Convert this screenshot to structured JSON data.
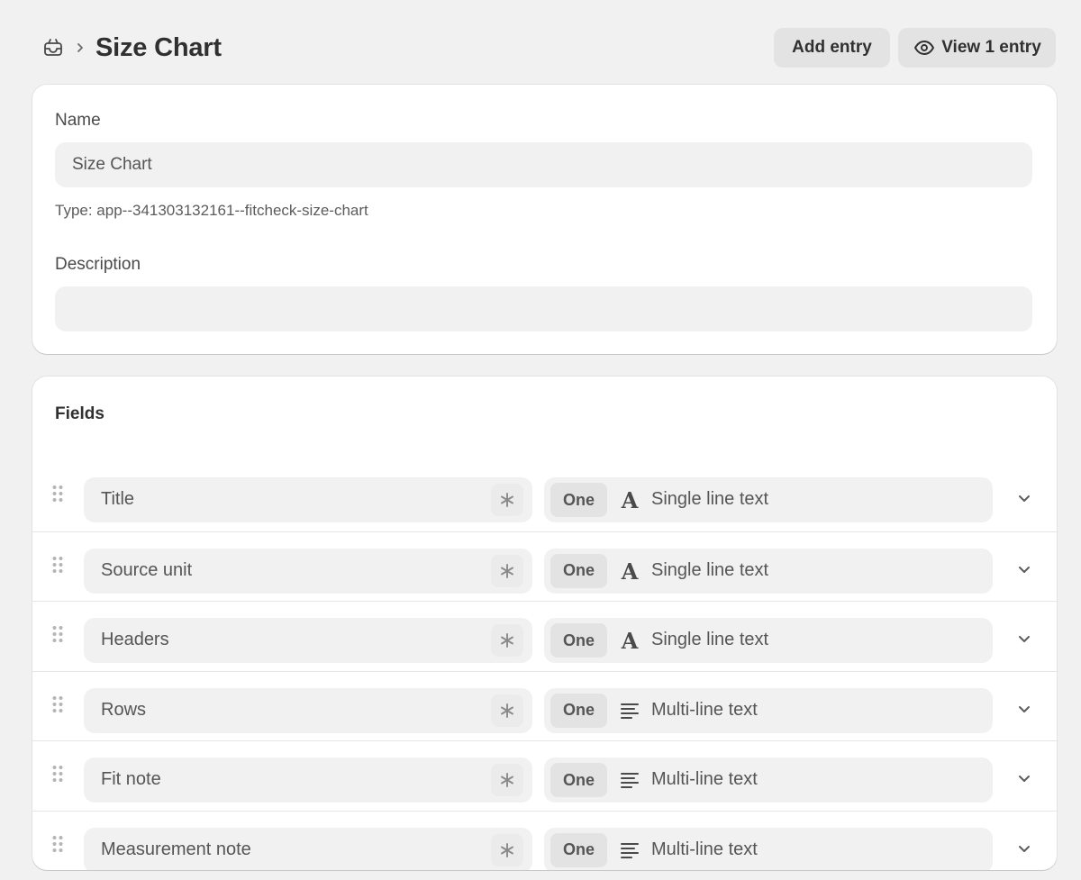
{
  "header": {
    "breadcrumb_icon": "metaobject-icon",
    "title": "Size Chart",
    "add_entry_label": "Add entry",
    "view_entry_label": "View 1 entry"
  },
  "definition": {
    "name_label": "Name",
    "name_value": "Size Chart",
    "type_line": "Type: app--341303132161--fitcheck-size-chart",
    "description_label": "Description",
    "description_value": ""
  },
  "fields": {
    "title": "Fields",
    "rows": [
      {
        "name": "Title",
        "cardinality": "One",
        "type": "Single line text",
        "type_icon": "text-A-icon"
      },
      {
        "name": "Source unit",
        "cardinality": "One",
        "type": "Single line text",
        "type_icon": "text-A-icon"
      },
      {
        "name": "Headers",
        "cardinality": "One",
        "type": "Single line text",
        "type_icon": "text-A-icon"
      },
      {
        "name": "Rows",
        "cardinality": "One",
        "type": "Multi-line text",
        "type_icon": "multiline-icon"
      },
      {
        "name": "Fit note",
        "cardinality": "One",
        "type": "Multi-line text",
        "type_icon": "multiline-icon"
      },
      {
        "name": "Measurement note",
        "cardinality": "One",
        "type": "Multi-line text",
        "type_icon": "multiline-icon"
      }
    ]
  },
  "colors": {
    "background": "#f1f1f1",
    "card": "#ffffff",
    "input": "#f1f1f1",
    "button": "#e3e3e3",
    "text": "#303030"
  }
}
